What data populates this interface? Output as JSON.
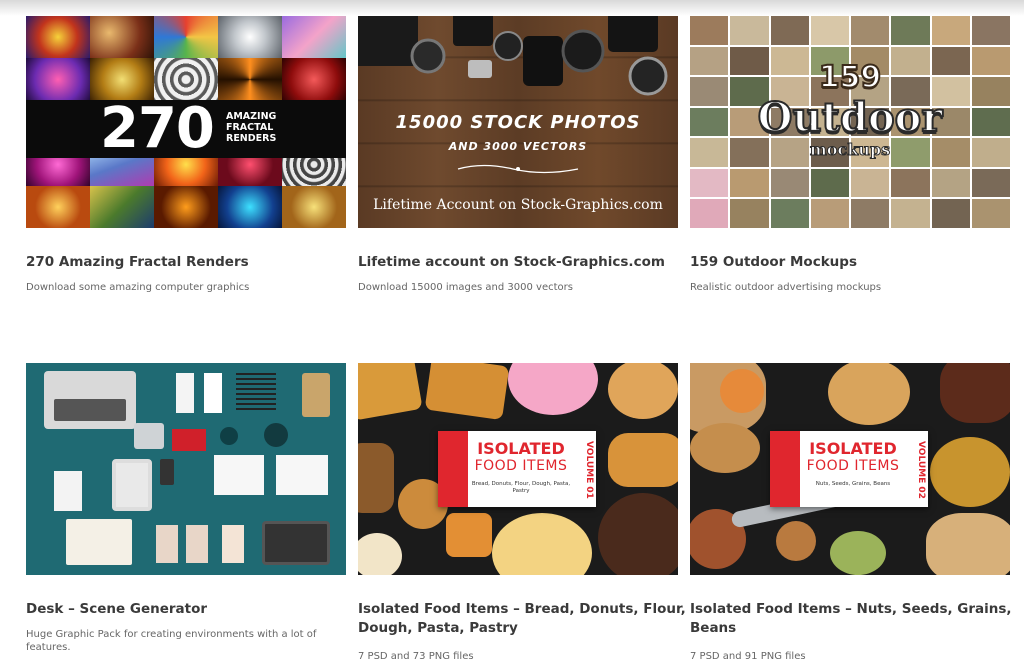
{
  "colors": {
    "title": "#3a3a3a",
    "description": "#666666",
    "food_label_red": "#e0262e",
    "desk_background": "#1f6a73"
  },
  "cards": [
    {
      "title": "270 Amazing Fractal Renders",
      "description": "Download some amazing computer graphics",
      "image": {
        "number": "270",
        "subtitle": "AMAZING FRACTAL RENDERS"
      }
    },
    {
      "title": "Lifetime account on Stock-Graphics.com",
      "description": "Download 15000 images and 3000 vectors",
      "image": {
        "line1": "15000 STOCK PHOTOS",
        "line2": "AND 3000 VECTORS",
        "line3": "Lifetime Account on Stock-Graphics.com"
      }
    },
    {
      "title": "159 Outdoor Mockups",
      "description": "Realistic outdoor advertising mockups",
      "image": {
        "number": "159",
        "word": "Outdoor",
        "sub": "mockups"
      }
    },
    {
      "title": "Desk – Scene Generator",
      "description": "Huge Graphic Pack for creating environments with a lot of features."
    },
    {
      "title": "Isolated Food Items – Bread, Donuts, Flour, Dough, Pasta, Pastry",
      "description": "7 PSD and 73 PNG files",
      "image": {
        "label1": "ISOLATED",
        "label2": "FOOD ITEMS",
        "small": "Bread, Donuts, Flour, Dough, Pasta, Pastry",
        "volume": "VOLUME 01"
      }
    },
    {
      "title": "Isolated Food Items – Nuts, Seeds, Grains, Beans",
      "description": "7 PSD and 91 PNG files",
      "image": {
        "label1": "ISOLATED",
        "label2": "FOOD ITEMS",
        "small": "Nuts, Seeds, Grains, Beans",
        "volume": "VOLUME 02"
      }
    }
  ]
}
